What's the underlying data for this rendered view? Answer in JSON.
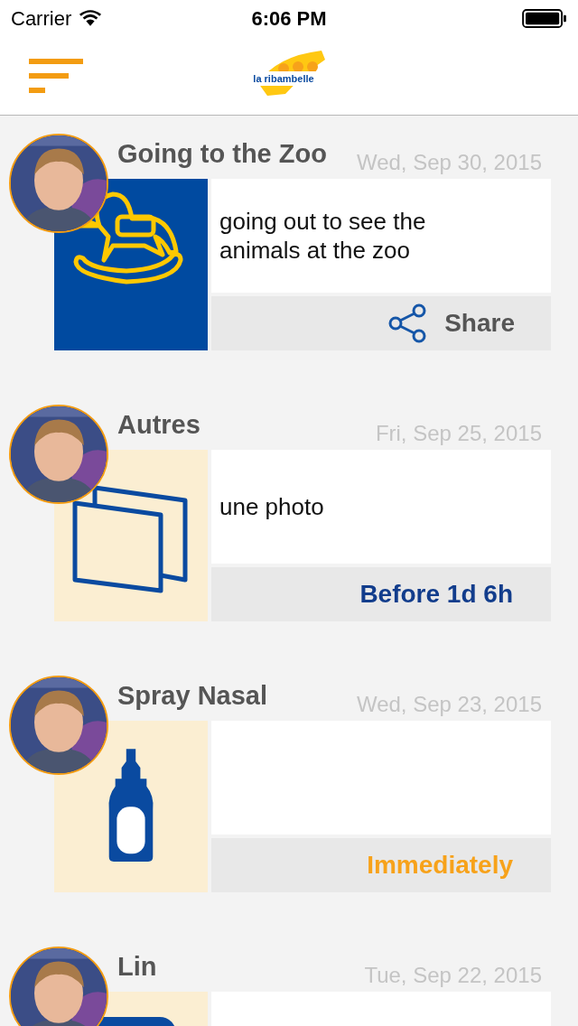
{
  "status_bar": {
    "carrier": "Carrier",
    "time": "6:06 PM"
  },
  "nav": {
    "logo_text": "la ribambelle"
  },
  "events": [
    {
      "title": "Going to the Zoo",
      "date": "Wed, Sep 30, 2015",
      "color": "#004aa0",
      "kind": "rocking-horse",
      "description": "going out to see the animals at the zoo",
      "footer": {
        "kind": "share",
        "text": "Share"
      }
    },
    {
      "title": "Autres",
      "date": "Fri, Sep 25, 2015",
      "color": "#fbeed2",
      "description": "une photo",
      "footer": {
        "kind": "time",
        "text": "Before 1d 6h",
        "color": "#123d8c"
      }
    },
    {
      "title": "Spray Nasal",
      "date": "Wed, Sep 23, 2015",
      "color": "#fbeed2",
      "kind": "bottle",
      "footer": {
        "kind": "time",
        "text": "Immediately",
        "color": "#f7a21a"
      }
    },
    {
      "title": "Lin",
      "date": "Tue, Sep 22, 2015",
      "color": "#fbeed2",
      "kind": "partial"
    }
  ]
}
